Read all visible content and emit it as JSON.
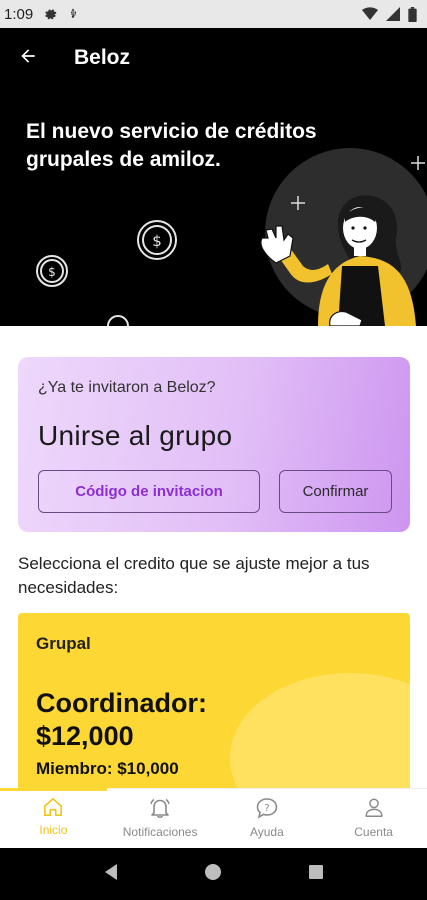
{
  "status_bar": {
    "time": "1:09"
  },
  "app_bar": {
    "title": "Beloz"
  },
  "hero": {
    "title": "El nuevo servicio de créditos grupales de amiloz."
  },
  "invite": {
    "question": "¿Ya te invitaron a Beloz?",
    "title": "Unirse al grupo",
    "code_button": "Código de invitacion",
    "confirm_button": "Confirmar"
  },
  "select_text": "Selecciona el credito que se ajuste mejor a tus necesidades:",
  "credit_card": {
    "type": "Grupal",
    "coordinator_label": "Coordinador:",
    "coordinator_amount": "$12,000",
    "member_line": "Miembro: $10,000"
  },
  "bottom_nav": {
    "items": [
      {
        "label": "Inicio",
        "icon": "home-icon",
        "active": true
      },
      {
        "label": "Notificaciones",
        "icon": "bell-icon",
        "active": false
      },
      {
        "label": "Ayuda",
        "icon": "help-chat-icon",
        "active": false
      },
      {
        "label": "Cuenta",
        "icon": "person-icon",
        "active": false
      }
    ]
  },
  "colors": {
    "accent_yellow": "#fdd835",
    "invite_purple": "#e2bff7",
    "code_button_text": "#8a2fd0",
    "active_nav": "#f0c419"
  }
}
